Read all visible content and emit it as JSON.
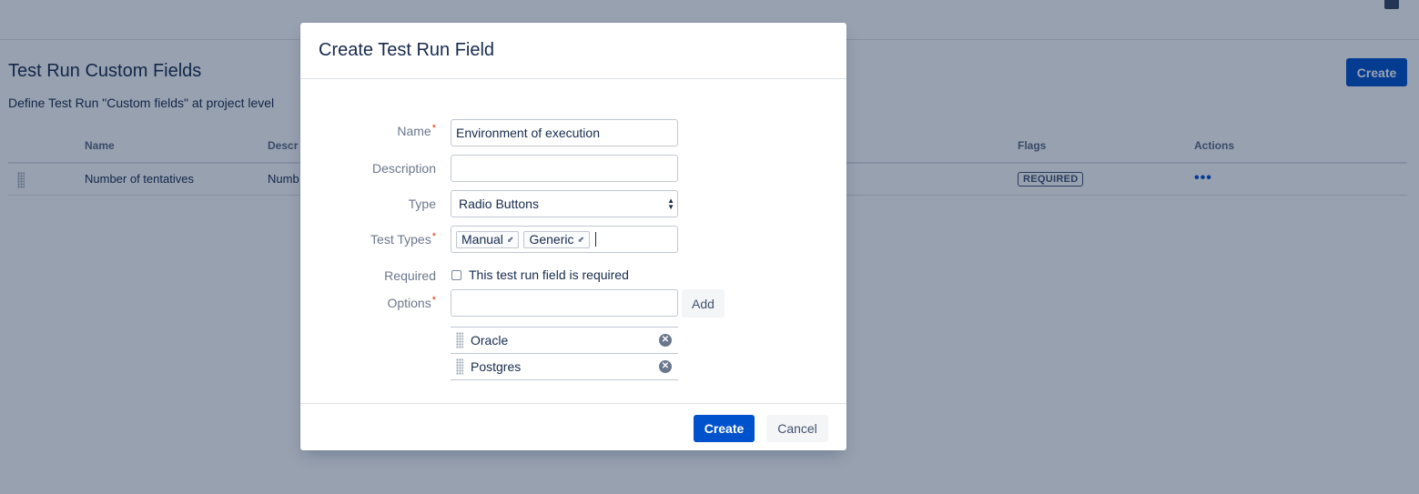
{
  "page": {
    "title": "Test Run Custom Fields",
    "description": "Define Test Run \"Custom fields\" at project level",
    "create_label": "Create",
    "table": {
      "columns": [
        "Name",
        "Descr",
        "Flags",
        "Actions"
      ],
      "rows": [
        {
          "name": "Number of tentatives",
          "description": "Numb",
          "flag": "REQUIRED",
          "actions": "•••"
        }
      ]
    }
  },
  "dialog": {
    "title": "Create Test Run Field",
    "required_marker": "*",
    "fields": {
      "name": {
        "label": "Name",
        "value": "Environment of execution"
      },
      "description": {
        "label": "Description",
        "value": ""
      },
      "type": {
        "label": "Type",
        "value": "Radio Buttons"
      },
      "test_types": {
        "label": "Test Types",
        "tags": [
          "Manual",
          "Generic"
        ]
      },
      "required": {
        "label": "Required",
        "checkbox_label": "This test run field is required",
        "checked": false
      },
      "options": {
        "label": "Options",
        "value": "",
        "add_label": "Add",
        "items": [
          "Oracle",
          "Postgres"
        ]
      }
    },
    "footer": {
      "create_label": "Create",
      "cancel_label": "Cancel"
    }
  },
  "colors": {
    "primary": "#0052cc",
    "required": "#de350b",
    "blanket": "rgba(9, 30, 66, 0.42)"
  }
}
